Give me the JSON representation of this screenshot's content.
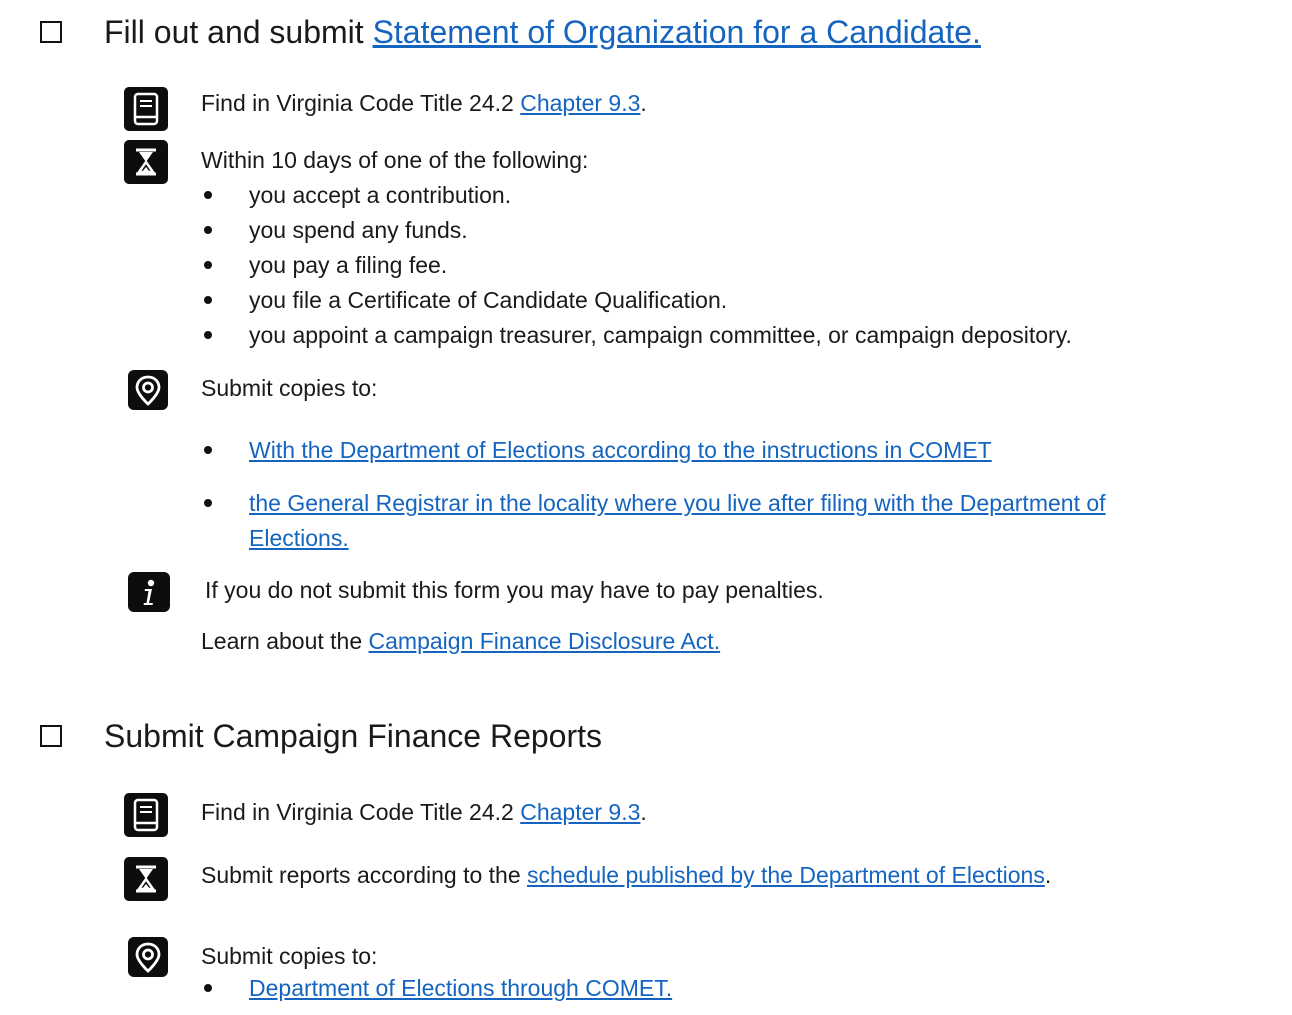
{
  "section1": {
    "heading_prefix": "Fill out and submit ",
    "heading_link": "Statement of Organization for a Candidate.",
    "code_prefix": "Find in Virginia Code Title 24.2 ",
    "code_link": "Chapter 9.3",
    "code_suffix": ".",
    "deadline_intro": "Within 10 days of one of the following:",
    "deadline_items": [
      "you accept a contribution.",
      "you spend any funds.",
      "you pay a filing fee.",
      "you file a Certificate of Candidate Qualification.",
      "you appoint a campaign treasurer, campaign committee, or campaign depository."
    ],
    "submit_intro": "Submit copies to:",
    "submit_links": [
      "With the Department of Elections according to the instructions in COMET",
      "the General Registrar in the locality where you live after filing with the Department of",
      "Elections."
    ],
    "info_text": "If you do not submit this form you may have to pay penalties.",
    "learn_prefix": "Learn about the ",
    "learn_link": "Campaign Finance Disclosure Act."
  },
  "section2": {
    "heading": "Submit Campaign Finance Reports",
    "code_prefix": "Find in Virginia Code Title 24.2 ",
    "code_link": "Chapter 9.3",
    "code_suffix": ".",
    "schedule_prefix": "Submit reports according to the ",
    "schedule_link": "schedule published by the Department of Elections",
    "schedule_suffix": ".",
    "submit_intro": "Submit copies to:",
    "submit_link": "Department of Elections through COMET."
  },
  "icons": {
    "law": "book-icon",
    "deadline": "hourglass-icon",
    "location": "location-pin-icon",
    "info": "info-icon"
  },
  "colors": {
    "link": "#1565c0",
    "text": "#1a1a1a",
    "icon_bg": "#0d0d0d"
  }
}
